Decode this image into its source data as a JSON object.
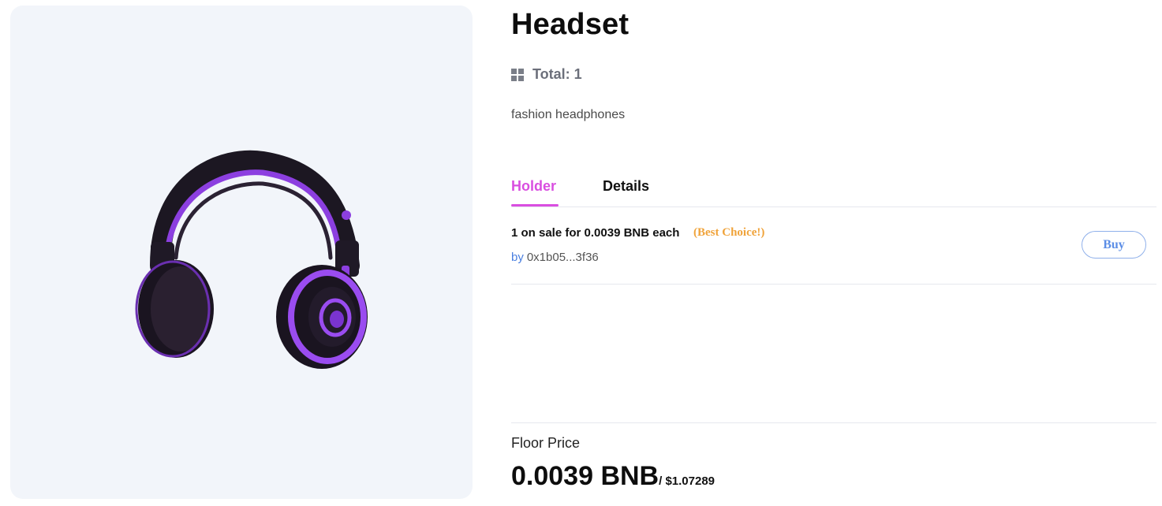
{
  "item": {
    "title": "Headset",
    "total_label": "Total:",
    "total_value": "1",
    "description": "fashion headphones"
  },
  "tabs": [
    {
      "label": "Holder",
      "active": true
    },
    {
      "label": "Details",
      "active": false
    }
  ],
  "listing": {
    "sale_text": "1 on sale for 0.0039 BNB each",
    "badge": "(Best Choice!)",
    "by_label": "by",
    "seller": "0x1b05...3f36",
    "buy_label": "Buy"
  },
  "floor": {
    "label": "Floor Price",
    "price": "0.0039 BNB",
    "usd": "/ $1.07289"
  },
  "colors": {
    "accent": "#d94ee0",
    "badge": "#f0a33a",
    "link": "#4a7fe0",
    "panel_bg": "#f2f5fa"
  },
  "icons": {
    "total": "grid-icon",
    "item_image": "headphones-image"
  }
}
